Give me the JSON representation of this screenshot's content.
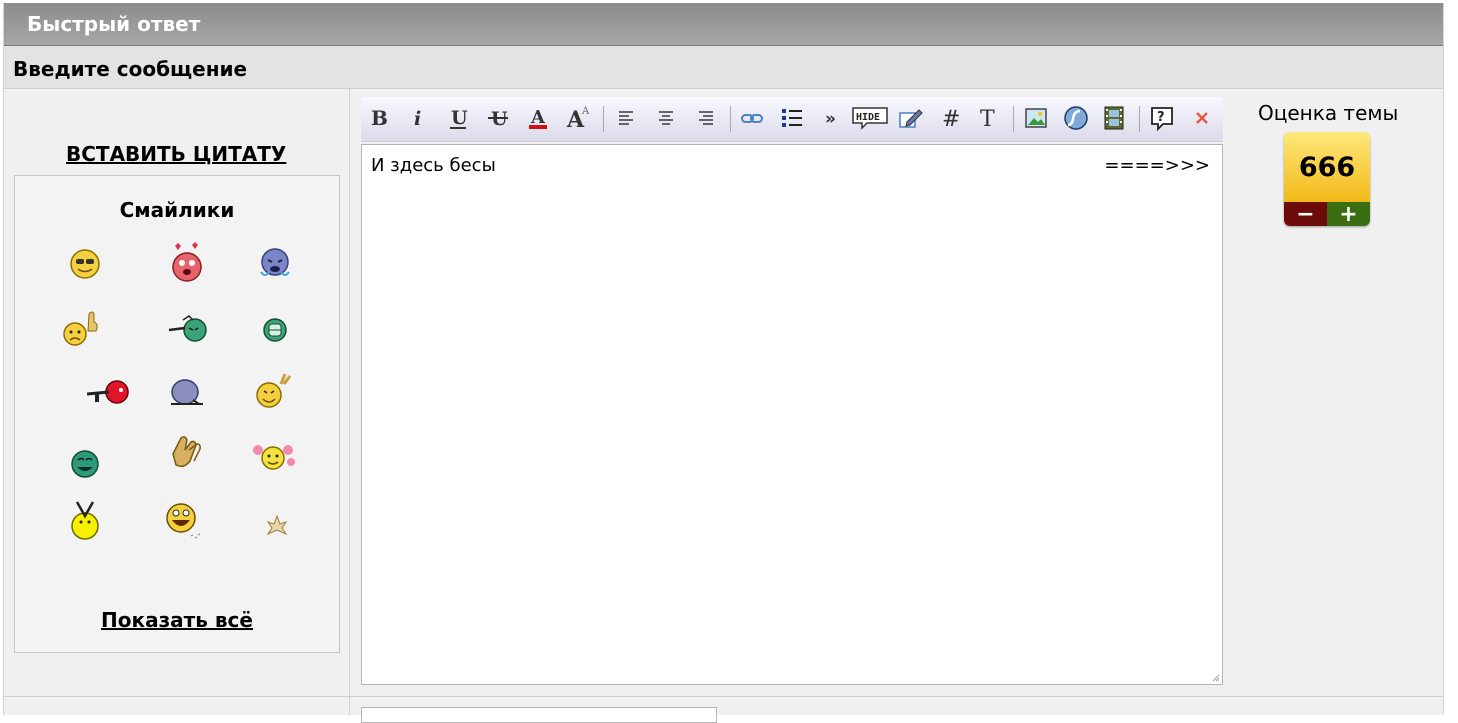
{
  "header": {
    "title": "Быстрый ответ"
  },
  "subheader": {
    "title": "Введите сообщение"
  },
  "left": {
    "quote_link": "ВСТАВИТЬ ЦИТАТУ",
    "smilies_title": "Смайлики",
    "show_all": "Показать всё",
    "smilies": [
      "cool-smiley",
      "in-love-smiley",
      "crying-smiley",
      "thumbs-up-sad-smiley",
      "shooting-smiley",
      "robot-smiley",
      "gun-smiley",
      "bowing-smiley",
      "victory-smiley",
      "laughing-smiley",
      "clapping-hands",
      "cheerleader-smiley",
      "jumping-smiley",
      "big-grin-smiley",
      "tiny-star-smiley"
    ]
  },
  "toolbar": {
    "buttons": [
      "bold",
      "italic",
      "underline",
      "strikethrough",
      "font-color",
      "font-size",
      "align-left",
      "align-center",
      "align-right",
      "link",
      "list",
      "quote",
      "hide",
      "edit",
      "code",
      "font",
      "image",
      "flash",
      "video",
      "help",
      "close"
    ]
  },
  "editor": {
    "text": "И здесь бесы",
    "text_right": "====>>>"
  },
  "rating": {
    "label": "Оценка темы",
    "value": "666",
    "minus": "−",
    "plus": "+"
  },
  "colors": {
    "header_bg": "#9a9a9a",
    "rating_yellow": "#f7cf2f",
    "minus_bg": "#6e0b0b",
    "plus_bg": "#3a6e10"
  }
}
